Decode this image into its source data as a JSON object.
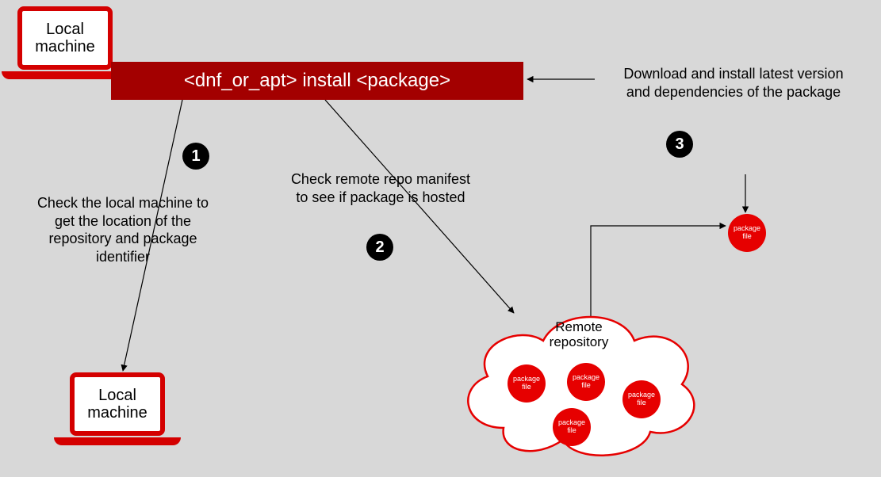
{
  "laptop_top": {
    "label": "Local\nmachine"
  },
  "laptop_bottom": {
    "label": "Local\nmachine"
  },
  "command": "<dnf_or_apt> install <package>",
  "steps": {
    "one": {
      "num": "1",
      "text": "Check the local machine\nto get the location of the\nrepository and package\nidentifier"
    },
    "two": {
      "num": "2",
      "text": "Check remote repo\nmanifest to see if package\nis hosted"
    },
    "three": {
      "num": "3",
      "text": "Download and install\nlatest version and dependencies\nof the package"
    }
  },
  "cloud": {
    "label": "Remote\nrepository"
  },
  "pkg_label": "package\nfile",
  "colors": {
    "red": "#e60000",
    "darkred": "#a30000"
  }
}
